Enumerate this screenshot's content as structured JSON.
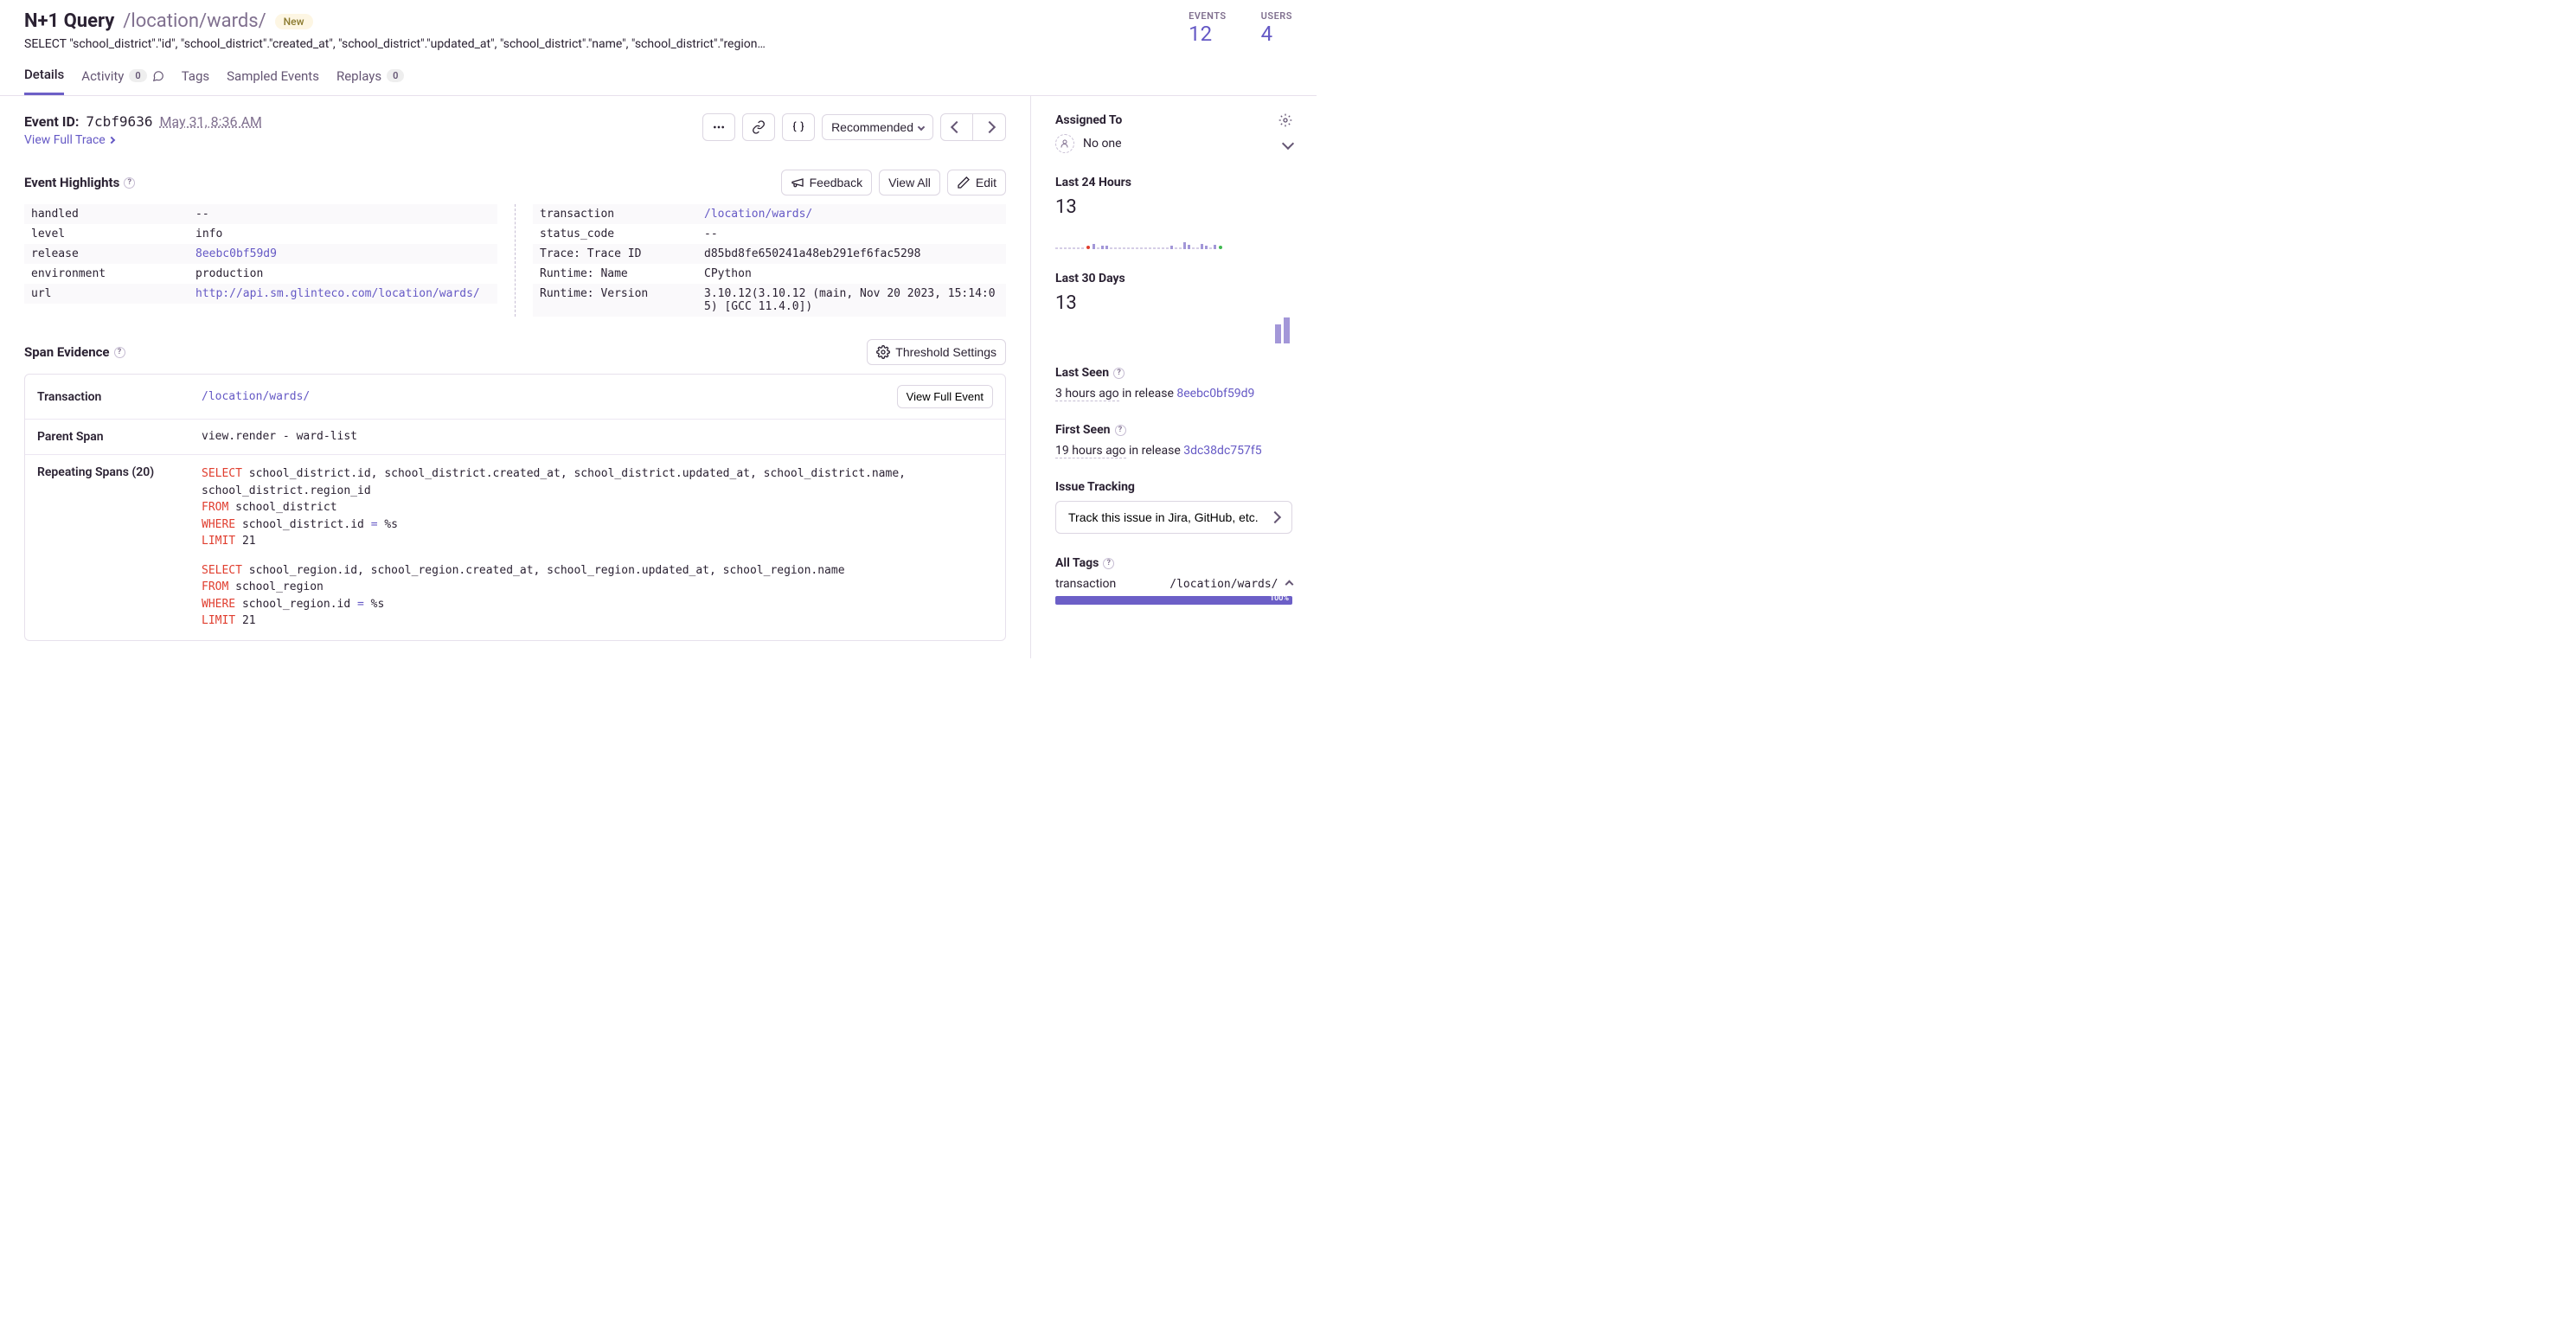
{
  "header": {
    "title": "N+1 Query",
    "path": "/location/wards/",
    "badge": "New",
    "subtitle": "SELECT \"school_district\".\"id\", \"school_district\".\"created_at\", \"school_district\".\"updated_at\", \"school_district\".\"name\", \"school_district\".\"region…",
    "events_label": "EVENTS",
    "events_value": "12",
    "users_label": "USERS",
    "users_value": "4"
  },
  "tabs": {
    "details": "Details",
    "activity": "Activity",
    "activity_count": "0",
    "tags": "Tags",
    "sampled": "Sampled Events",
    "replays": "Replays",
    "replays_count": "0"
  },
  "event": {
    "id_label": "Event ID:",
    "id": "7cbf9636",
    "time": "May 31, 8:36 AM",
    "full_trace": "View Full Trace",
    "recommended": "Recommended"
  },
  "event_actions": {
    "feedback": "Feedback",
    "view_all": "View All",
    "edit": "Edit"
  },
  "highlights": {
    "title": "Event Highlights",
    "left": [
      {
        "k": "handled",
        "v": "--"
      },
      {
        "k": "level",
        "v": "info"
      },
      {
        "k": "release",
        "v": "8eebc0bf59d9",
        "link": true
      },
      {
        "k": "environment",
        "v": "production"
      },
      {
        "k": "url",
        "v": "http://api.sm.glinteco.com/location/wards/",
        "link": true
      }
    ],
    "right": [
      {
        "k": "transaction",
        "v": "/location/wards/",
        "link": true
      },
      {
        "k": "status_code",
        "v": "--"
      },
      {
        "k": "Trace: Trace ID",
        "v": "d85bd8fe650241a48eb291ef6fac5298"
      },
      {
        "k": "Runtime: Name",
        "v": "CPython"
      },
      {
        "k": "Runtime: Version",
        "v": "3.10.12(3.10.12 (main, Nov 20 2023, 15:14:05) [GCC 11.4.0])"
      }
    ]
  },
  "span_evidence": {
    "title": "Span Evidence",
    "threshold": "Threshold Settings",
    "transaction_label": "Transaction",
    "transaction_value": "/location/wards/",
    "view_full_event": "View Full Event",
    "parent_label": "Parent Span",
    "parent_value": "view.render - ward-list",
    "repeating_label": "Repeating Spans (20)",
    "sql1": {
      "select": "SELECT",
      "cols": " school_district.id, school_district.created_at, school_district.updated_at, school_district.name, school_district.region_id",
      "from": "FROM",
      "table": " school_district",
      "where": "WHERE",
      "cond_l": " school_district.id ",
      "eq": "=",
      "cond_r": " %s",
      "limit": "LIMIT",
      "limnum": " 21"
    },
    "sql2": {
      "select": "SELECT",
      "cols": " school_region.id, school_region.created_at, school_region.updated_at, school_region.name",
      "from": "FROM",
      "table": " school_region",
      "where": "WHERE",
      "cond_l": " school_region.id ",
      "eq": "=",
      "cond_r": " %s",
      "limit": "LIMIT",
      "limnum": " 21"
    }
  },
  "sidebar": {
    "assigned_label": "Assigned To",
    "assigned_value": "No one",
    "last24_label": "Last 24 Hours",
    "last24_value": "13",
    "last30_label": "Last 30 Days",
    "last30_value": "13",
    "last_seen_label": "Last Seen",
    "last_seen_ago": "3 hours ago",
    "last_seen_in": " in release ",
    "last_seen_rel": "8eebc0bf59d9",
    "first_seen_label": "First Seen",
    "first_seen_ago": "19 hours ago",
    "first_seen_in": " in release ",
    "first_seen_rel": "3dc38dc757f5",
    "issue_tracking_label": "Issue Tracking",
    "track_button": "Track this issue in Jira, GitHub, etc.",
    "all_tags_label": "All Tags",
    "tag_transaction_key": "transaction",
    "tag_transaction_val": "/location/wards/",
    "tag_transaction_pct": "100%"
  }
}
